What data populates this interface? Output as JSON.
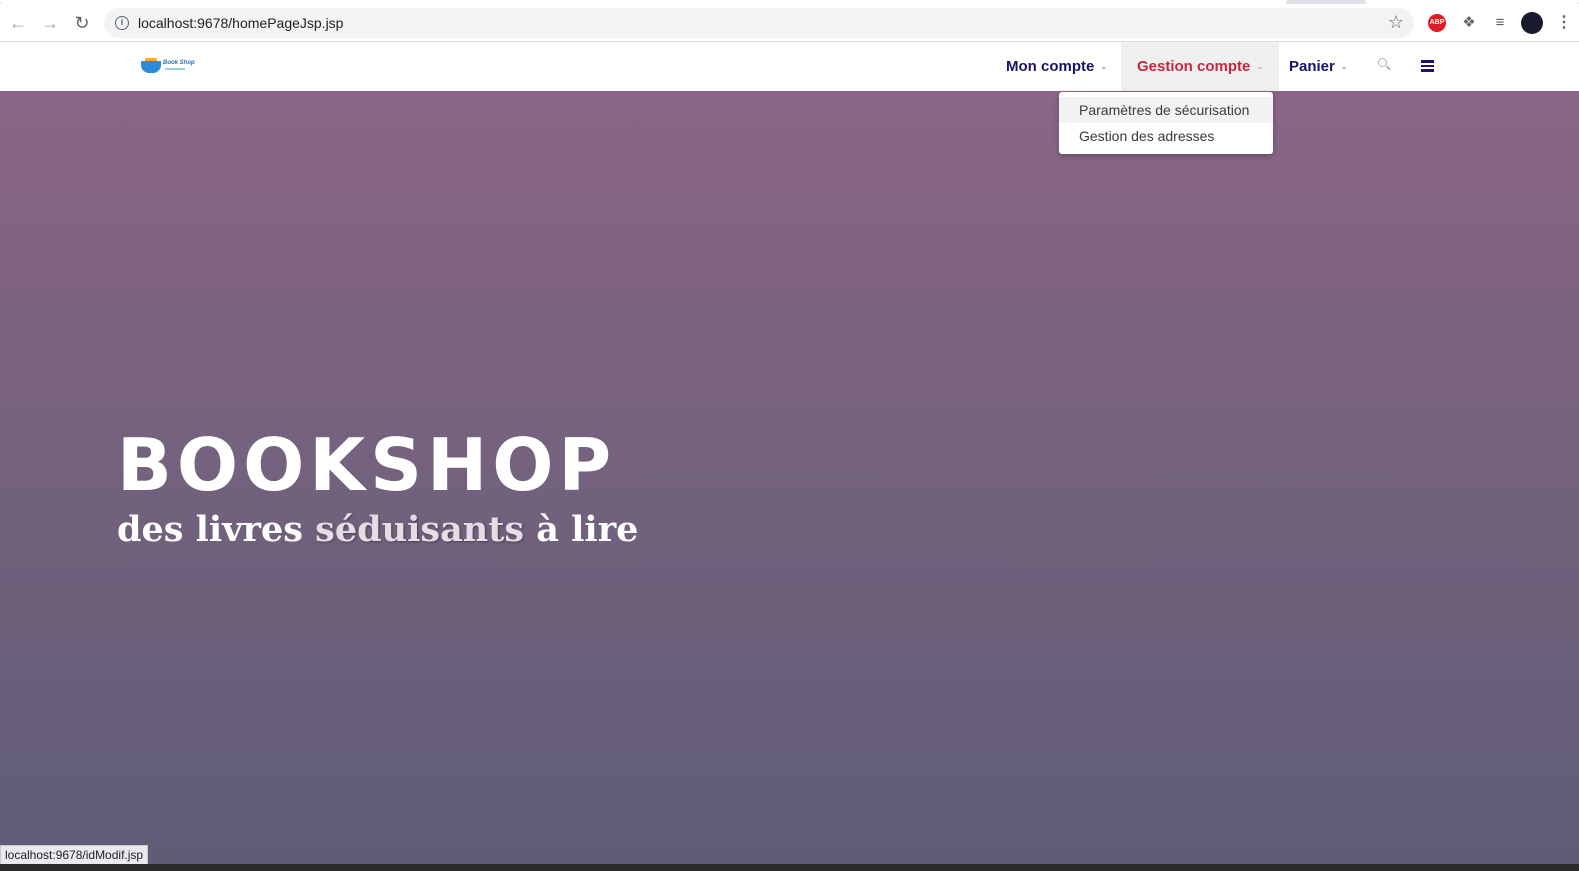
{
  "browser": {
    "url": "localhost:9678/homePageJsp.jsp",
    "status_url": "localhost:9678/idModif.jsp",
    "icons": {
      "back": "arrow-left",
      "forward": "arrow-right",
      "reload": "reload",
      "info": "info",
      "star": "star",
      "abp": "ABP",
      "extensions": "puzzle",
      "media": "playlist",
      "profile": "avatar",
      "menu": "kebab"
    }
  },
  "navbar": {
    "logo_text": "Book Shop",
    "items": [
      {
        "label": "Mon compte"
      },
      {
        "label": "Gestion compte"
      },
      {
        "label": "Panier"
      }
    ],
    "active_color": "#c3293f",
    "text_color": "#1b1464"
  },
  "dropdown": {
    "items": [
      {
        "label": "Paramètres de sécurisation"
      },
      {
        "label": "Gestion des adresses"
      }
    ]
  },
  "hero": {
    "title": "BOOKSHOP",
    "subtitle_part1": "des livres ",
    "subtitle_highlight": "séduisants",
    "subtitle_part2": " à lire"
  }
}
